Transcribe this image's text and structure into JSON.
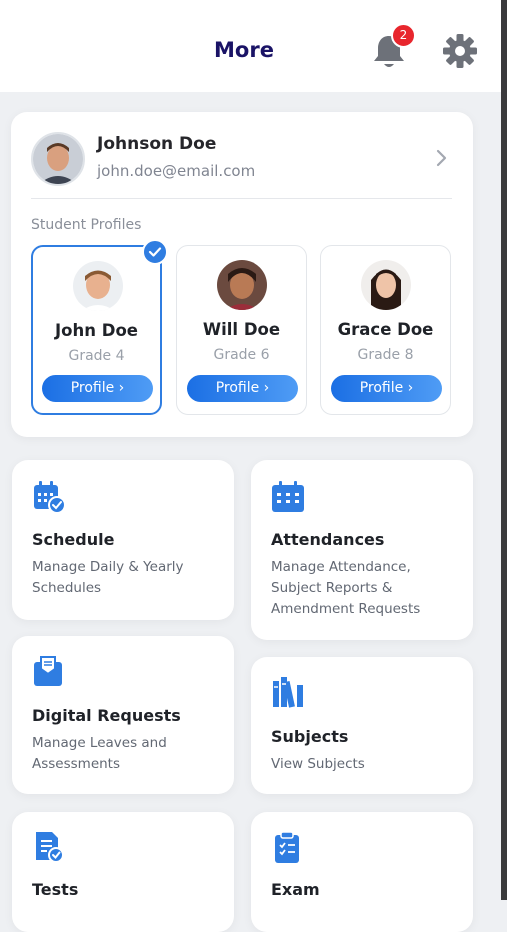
{
  "header": {
    "title": "More",
    "notification_count": "2",
    "accent": "#1a1366"
  },
  "user": {
    "name": "Johnson Doe",
    "email": "john.doe@email.com"
  },
  "student_profiles": {
    "label": "Student Profiles",
    "items": [
      {
        "name": "John Doe",
        "grade": "Grade 4",
        "button": "Profile ›",
        "selected": true
      },
      {
        "name": "Will Doe",
        "grade": "Grade 6",
        "button": "Profile ›",
        "selected": false
      },
      {
        "name": "Grace Doe",
        "grade": "Grade 8",
        "button": "Profile ›",
        "selected": false
      }
    ]
  },
  "tiles": [
    {
      "title": "Schedule",
      "desc": "Manage Daily & Yearly Schedules",
      "icon": "calendar-check-icon"
    },
    {
      "title": "Attendances",
      "desc": "Manage Attendance, Subject Reports & Amendment Requests",
      "icon": "calendar-grid-icon"
    },
    {
      "title": "Digital Requests",
      "desc": "Manage Leaves and Assessments",
      "icon": "envelope-tray-icon"
    },
    {
      "title": "Subjects",
      "desc": "View Subjects",
      "icon": "books-icon"
    },
    {
      "title": "Tests",
      "desc": "",
      "icon": "test-document-icon"
    },
    {
      "title": "Exam",
      "desc": "",
      "icon": "clipboard-icon"
    }
  ],
  "colors": {
    "primary_blue": "#2f7de1",
    "badge_red": "#e8262d",
    "page_bg": "#eef0f3"
  }
}
